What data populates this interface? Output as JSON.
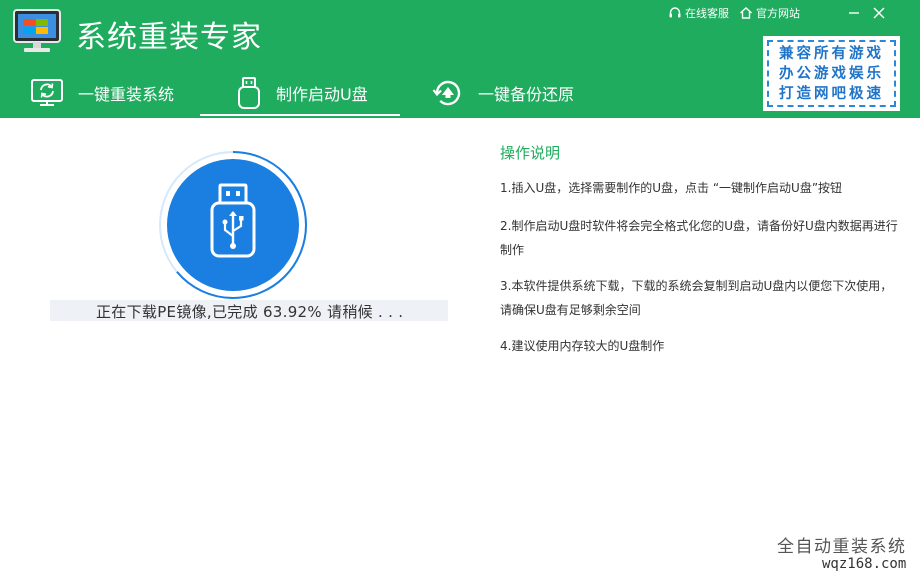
{
  "app": {
    "title": "系统重装专家"
  },
  "top_links": {
    "support_label": "在线客服",
    "website_label": "官方网站"
  },
  "promo": {
    "lines": [
      "兼容所有游戏",
      "办公游戏娱乐",
      "打造网吧极速"
    ]
  },
  "tabs": [
    {
      "label": "一键重装系统",
      "icon": "refresh-monitor-icon",
      "active": false
    },
    {
      "label": "制作启动U盘",
      "icon": "usb-drive-icon",
      "active": true
    },
    {
      "label": "一键备份还原",
      "icon": "backup-restore-icon",
      "active": false
    }
  ],
  "progress": {
    "status_text": "正在下载PE镜像,已完成 63.92% 请稍候 . . .",
    "percent": 63.92
  },
  "instructions": {
    "title": "操作说明",
    "items": [
      "1.插入U盘，选择需要制作的U盘，点击 “一键制作启动U盘”按钮",
      "2.制作启动U盘时软件将会完全格式化您的U盘，请备份好U盘内数据再进行制作",
      "3.本软件提供系统下载，下载的系统会复制到启动U盘内以便您下次使用，请确保U盘有足够剩余空间",
      "4.建议使用内存较大的U盘制作"
    ]
  },
  "watermark": {
    "line1": "全自动重装系统",
    "line2": "wqz168.com"
  },
  "colors": {
    "header_green": "#1fac5e",
    "progress_blue": "#1a7fe0",
    "promo_blue": "#1f74c9"
  }
}
